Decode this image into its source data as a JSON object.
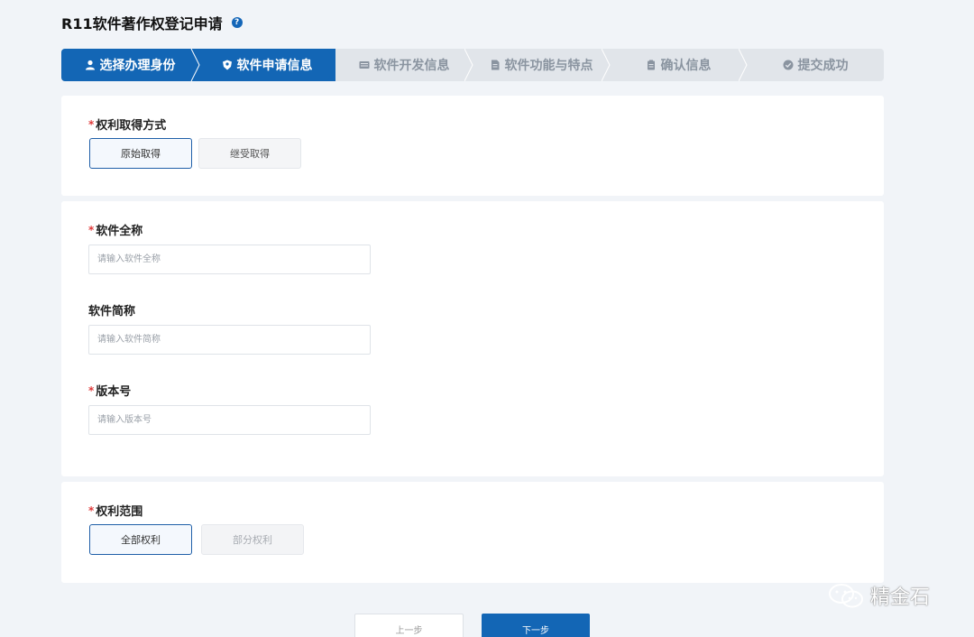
{
  "page": {
    "title": "R11软件著作权登记申请",
    "help_icon": "question-circle-icon"
  },
  "steps": [
    {
      "label": "选择办理身份",
      "icon": "user-icon",
      "state": "active"
    },
    {
      "label": "软件申请信息",
      "icon": "shield-icon",
      "state": "active"
    },
    {
      "label": "软件开发信息",
      "icon": "keyboard-icon",
      "state": "pending"
    },
    {
      "label": "软件功能与特点",
      "icon": "document-icon",
      "state": "pending"
    },
    {
      "label": "确认信息",
      "icon": "clipboard-icon",
      "state": "pending"
    },
    {
      "label": "提交成功",
      "icon": "check-circle-icon",
      "state": "pending"
    }
  ],
  "acquisition": {
    "label": "权利取得方式",
    "required": "*",
    "options": [
      "原始取得",
      "继受取得"
    ],
    "selected": "原始取得"
  },
  "software": {
    "full_name": {
      "label": "软件全称",
      "required": "*",
      "placeholder": "请输入软件全称",
      "value": ""
    },
    "short_name": {
      "label": "软件简称",
      "placeholder": "请输入软件简称",
      "value": ""
    },
    "version": {
      "label": "版本号",
      "required": "*",
      "placeholder": "请输入版本号",
      "value": ""
    }
  },
  "scope": {
    "label": "权利范围",
    "required": "*",
    "options": [
      "全部权利",
      "部分权利"
    ],
    "selected": "全部权利"
  },
  "footer": {
    "prev_label": "上一步",
    "next_label": "下一步"
  },
  "watermark": {
    "text": "精金石"
  },
  "colors": {
    "primary": "#1366b5",
    "required": "#e03a3a",
    "background": "#f1f4f8",
    "step_inactive": "#e1e5ea"
  }
}
